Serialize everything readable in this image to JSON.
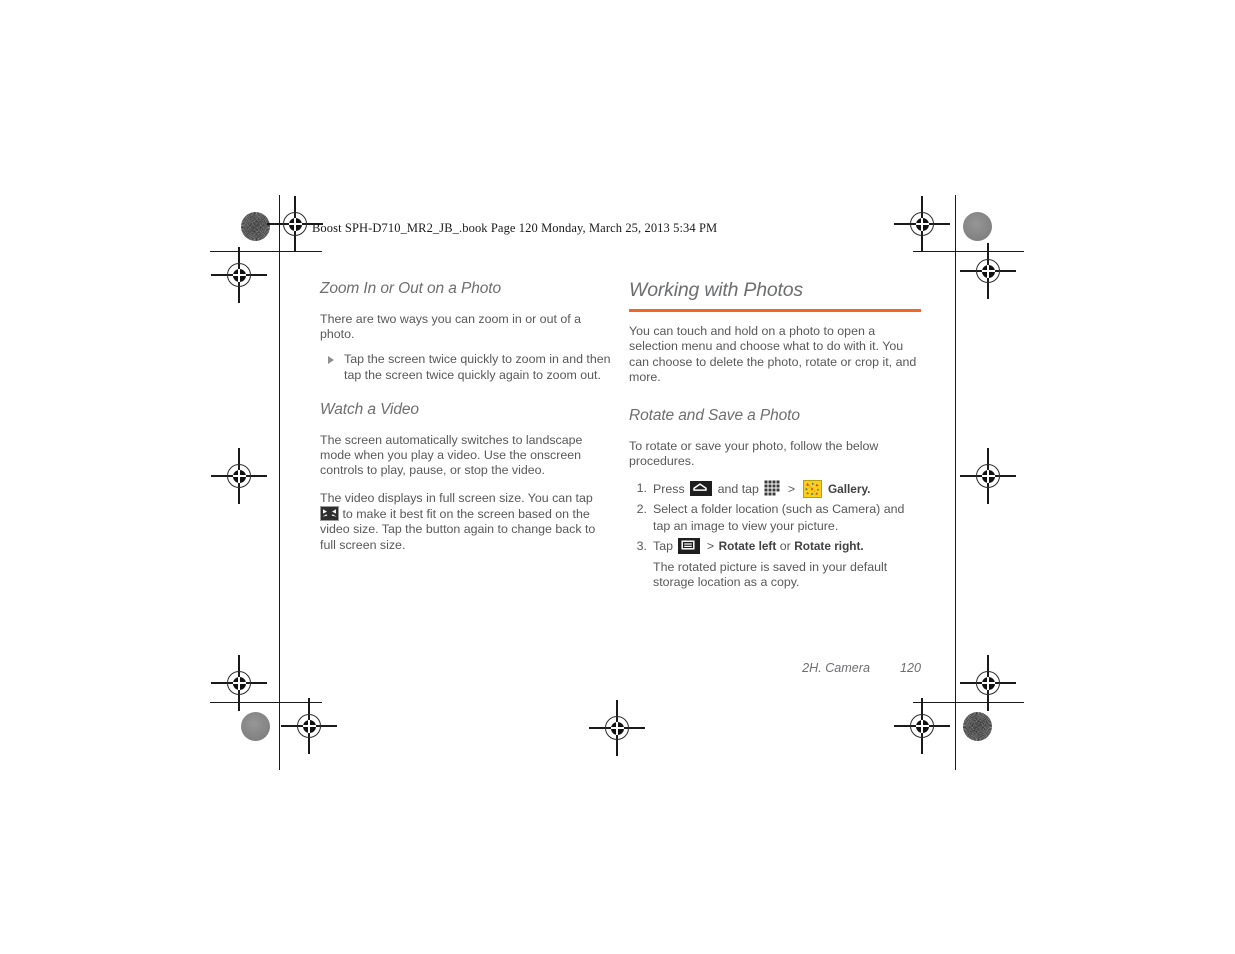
{
  "document": {
    "running_header": "Boost SPH-D710_MR2_JB_.book  Page 120  Monday, March 25, 2013  5:34 PM",
    "accent_color": "#f26522",
    "text_color": "#58585a",
    "heading_color": "#6d6e70"
  },
  "left_column": {
    "section_heading": "Zoom In or Out on a Photo",
    "intro_paragraph": "There are two ways you can zoom in or out of a photo.",
    "bullets": [
      "Tap the screen twice quickly to zoom in and then tap the screen twice quickly again to zoom out."
    ],
    "subsection_heading": "Watch a Video",
    "paragraph_1": "The screen automatically switches to landscape mode when you play a video. Use the onscreen controls to play, pause, or stop the video.",
    "paragraph_2_part1": "The video displays in full screen size. You can tap",
    "paragraph_2_part2": "to make it best fit on the screen based on the video size. Tap the button again to change back to full screen size.",
    "fit_icon_name": "fit-to-screen-icon"
  },
  "right_column": {
    "section_heading": "Working with Photos",
    "intro_paragraph": "You can touch and hold on a photo to open a selection menu and choose what to do with it. You can choose to delete the photo, rotate or crop it, and more.",
    "subsection_heading": "Rotate and Save a Photo",
    "lead_paragraph": "To rotate or save your photo, follow the below procedures.",
    "steps": [
      {
        "number": "1.",
        "text_before_home": "Press",
        "text_after_home": "and tap",
        "separator": ">",
        "app_label": "Gallery."
      },
      {
        "number": "2.",
        "text": "Select a folder location (such as Camera) and tap an image to view your picture."
      },
      {
        "number": "3.",
        "text_before_menu": "Tap",
        "separator": ">",
        "command_1": "Rotate left",
        "conjunction": "or",
        "command_2": "Rotate right.",
        "note": "The rotated picture is saved in your default storage location as a copy."
      }
    ]
  },
  "footer": {
    "chapter": "2H. Camera",
    "page_number": "120"
  }
}
